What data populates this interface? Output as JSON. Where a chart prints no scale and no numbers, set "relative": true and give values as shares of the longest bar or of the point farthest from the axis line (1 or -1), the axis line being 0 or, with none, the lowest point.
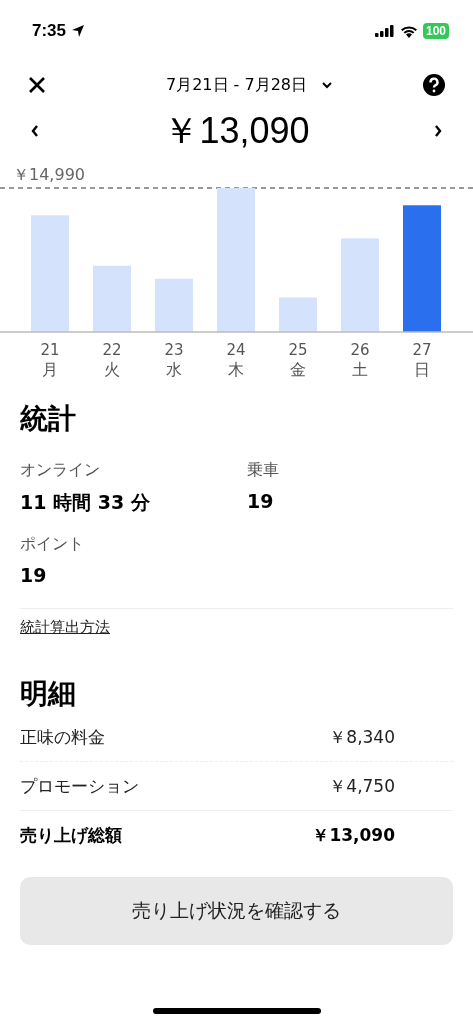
{
  "status_bar": {
    "time": "7:35",
    "battery": "100"
  },
  "header": {
    "date_range": "7月21日 - 7月28日"
  },
  "total": {
    "amount": "￥13,090"
  },
  "chart": {
    "chart_data": {
      "type": "bar",
      "relative": true,
      "categories": [
        "21",
        "22",
        "23",
        "24",
        "25",
        "26",
        "27"
      ],
      "annotations": [
        {
          "text": "￥14,990"
        }
      ],
      "series": [
        {
          "color": "#d5e2fb",
          "values": [
            0.81,
            0.46,
            0.37,
            1,
            0.24,
            0.65,
            null
          ]
        },
        {
          "color": "#2a6fee",
          "values": [
            null,
            null,
            null,
            null,
            null,
            null,
            0.88
          ]
        }
      ]
    },
    "weekdays": [
      "月",
      "火",
      "水",
      "木",
      "金",
      "土",
      "日"
    ]
  },
  "stats": {
    "title": "統計",
    "items": [
      {
        "label": "オンライン",
        "value": "11 時間 33 分"
      },
      {
        "label": "乗車",
        "value": "19"
      },
      {
        "label": "ポイント",
        "value": "19"
      }
    ],
    "link": "統計算出方法"
  },
  "breakdown": {
    "title": "明細",
    "rows": [
      {
        "label": "正味の料金",
        "value": "￥8,340",
        "kind": "line"
      },
      {
        "label": "プロモーション",
        "value": "￥4,750",
        "kind": "line"
      },
      {
        "label": "売り上げ総額",
        "value": "￥13,090",
        "kind": "total"
      }
    ]
  },
  "button": "売り上げ状況を確認する"
}
